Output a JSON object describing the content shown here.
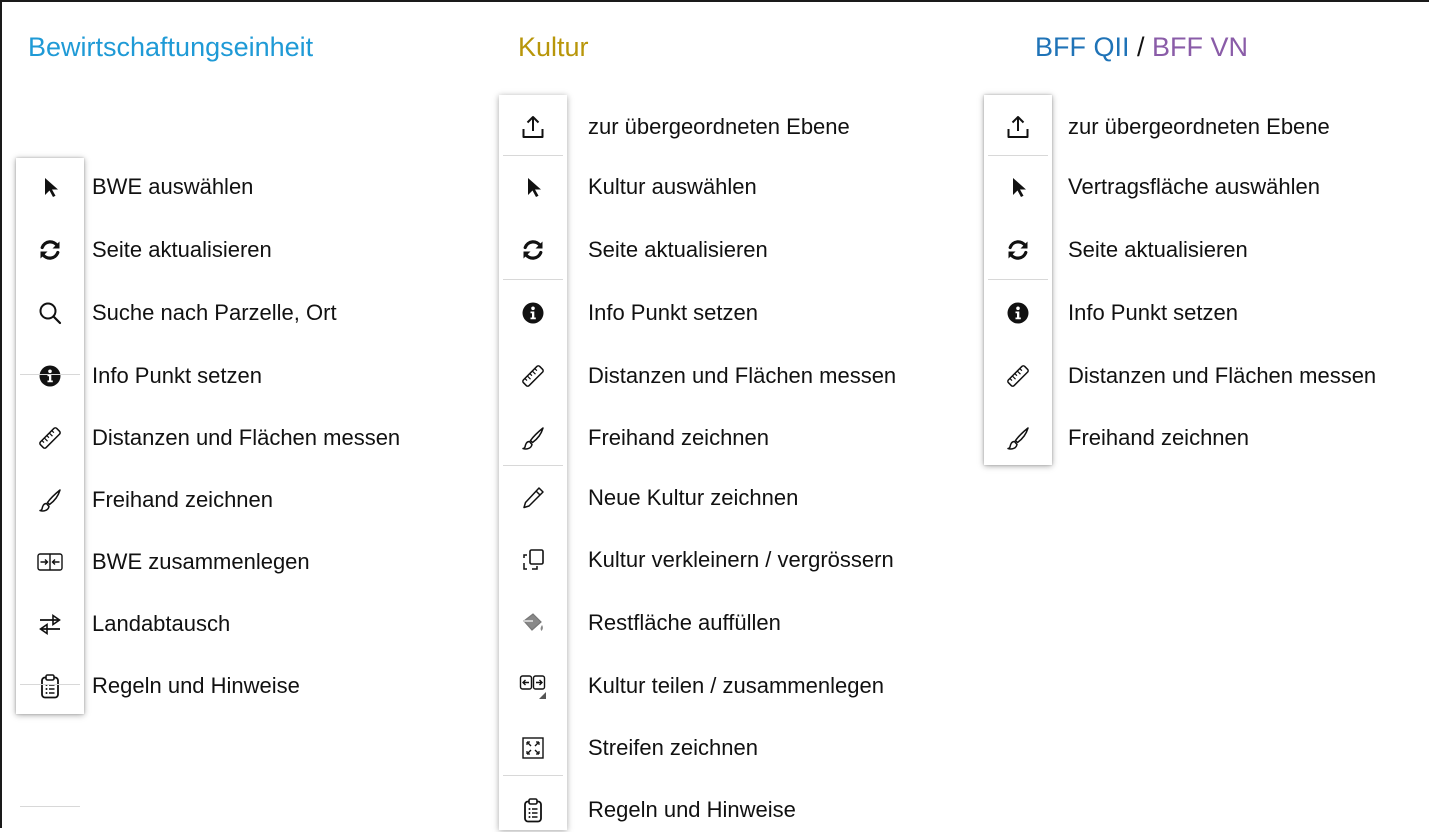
{
  "colors": {
    "bwe_heading": "#1f9ad6",
    "kultur_heading": "#b8960a",
    "bff_qii": "#1f73b7",
    "bff_vn": "#8a5ca8",
    "separator_slash": "#111111",
    "icon": "#111111"
  },
  "columns": {
    "bwe": {
      "heading": "Bewirtschaftungseinheit",
      "items": [
        {
          "icon": "cursor-icon",
          "label": "BWE auswählen"
        },
        {
          "icon": "refresh-icon",
          "label": "Seite aktualisieren"
        },
        {
          "icon": "search-icon",
          "label": "Suche nach Parzelle, Ort"
        },
        {
          "icon": "info-icon",
          "label": "Info Punkt setzen"
        },
        {
          "icon": "ruler-icon",
          "label": "Distanzen und Flächen messen"
        },
        {
          "icon": "brush-icon",
          "label": "Freihand zeichnen"
        },
        {
          "icon": "merge-icon",
          "label": "BWE zusammenlegen"
        },
        {
          "icon": "exchange-icon",
          "label": "Landabtausch"
        },
        {
          "icon": "clipboard-icon",
          "label": "Regeln und Hinweise"
        }
      ]
    },
    "kultur": {
      "heading": "Kultur",
      "items": [
        {
          "icon": "upload-icon",
          "label": "zur übergeordneten Ebene"
        },
        {
          "icon": "cursor-icon",
          "label": "Kultur auswählen"
        },
        {
          "icon": "refresh-icon",
          "label": "Seite aktualisieren"
        },
        {
          "icon": "info-icon",
          "label": "Info Punkt setzen"
        },
        {
          "icon": "ruler-icon",
          "label": "Distanzen und Flächen messen"
        },
        {
          "icon": "brush-icon",
          "label": "Freihand zeichnen"
        },
        {
          "icon": "pencil-icon",
          "label": "Neue Kultur zeichnen"
        },
        {
          "icon": "resize-icon",
          "label": "Kultur verkleinern / vergrössern"
        },
        {
          "icon": "paint-bucket-icon",
          "label": "Restfläche auffüllen"
        },
        {
          "icon": "split-icon",
          "label": "Kultur teilen / zusammenlegen"
        },
        {
          "icon": "stripes-icon",
          "label": "Streifen zeichnen"
        },
        {
          "icon": "clipboard-icon",
          "label": "Regeln und Hinweise"
        }
      ]
    },
    "bff": {
      "heading_qii": "BFF QII",
      "heading_sep": " / ",
      "heading_vn": "BFF VN",
      "items": [
        {
          "icon": "upload-icon",
          "label": "zur übergeordneten Ebene"
        },
        {
          "icon": "cursor-icon",
          "label": "Vertragsfläche auswählen"
        },
        {
          "icon": "refresh-icon",
          "label": "Seite aktualisieren"
        },
        {
          "icon": "info-icon",
          "label": "Info Punkt setzen"
        },
        {
          "icon": "ruler-icon",
          "label": "Distanzen und Flächen messen"
        },
        {
          "icon": "brush-icon",
          "label": "Freihand zeichnen"
        }
      ]
    }
  }
}
